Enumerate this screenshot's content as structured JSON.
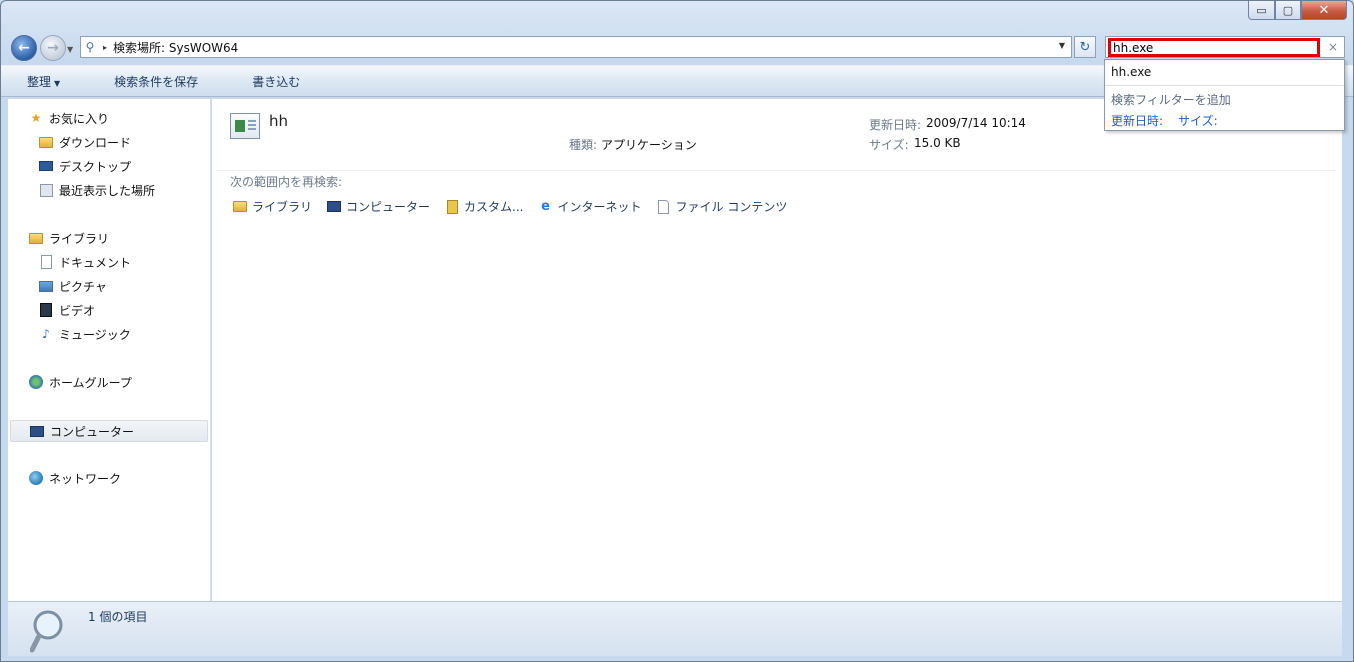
{
  "caption": {
    "minimize": "▭",
    "maximize": "▢",
    "close": "✕"
  },
  "address": {
    "arrow": "▸",
    "text": "検索場所: SysWOW64"
  },
  "search": {
    "value": "hh.exe",
    "clear": "×"
  },
  "toolbar": {
    "organize": "整理",
    "save_search": "検索条件を保存",
    "burn": "書き込む"
  },
  "suggest": {
    "item": "hh.exe",
    "filter_header": "検索フィルターを追加",
    "filter_date": "更新日時:",
    "filter_size": "サイズ:"
  },
  "sidebar": {
    "favorites": "お気に入り",
    "downloads": "ダウンロード",
    "desktop": "デスクトップ",
    "recent": "最近表示した場所",
    "libraries": "ライブラリ",
    "documents": "ドキュメント",
    "pictures": "ピクチャ",
    "videos": "ビデオ",
    "music": "ミュージック",
    "homegroup": "ホームグループ",
    "computer": "コンピューター",
    "network": "ネットワーク"
  },
  "result": {
    "name": "hh",
    "type_label": "種類:",
    "type_value": "アプリケーション",
    "date_label": "更新日時:",
    "date_value": "2009/7/14 10:14",
    "size_label": "サイズ:",
    "size_value": "15.0 KB"
  },
  "research": {
    "header": "次の範囲内を再検索:",
    "libraries": "ライブラリ",
    "computer": "コンピューター",
    "custom": "カスタム...",
    "internet": "インターネット",
    "file_contents": "ファイル コンテンツ"
  },
  "status": {
    "count": "1 個の項目"
  }
}
